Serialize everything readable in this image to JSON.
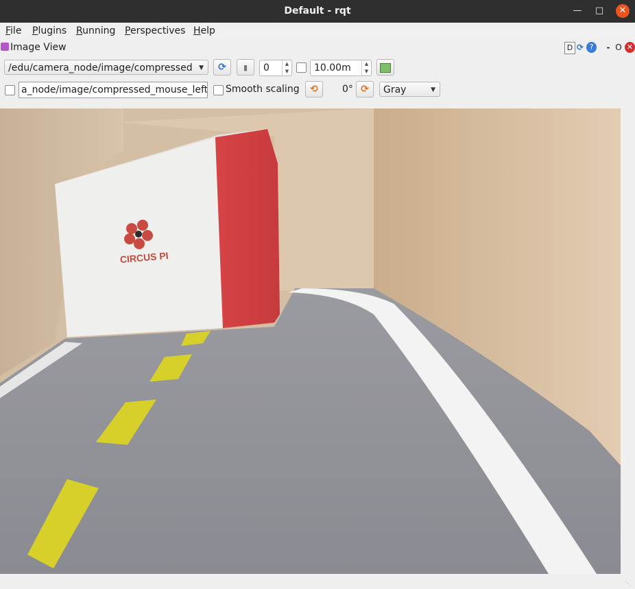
{
  "window": {
    "title": "Default - rqt"
  },
  "menu": [
    {
      "mnemonic": "F",
      "rest": "ile"
    },
    {
      "mnemonic": "P",
      "rest": "lugins"
    },
    {
      "mnemonic": "R",
      "rest": "unning"
    },
    {
      "mnemonic": "P",
      "rest": "erspectives"
    },
    {
      "mnemonic": "H",
      "rest": "elp"
    }
  ],
  "plugin": {
    "title": "Image View",
    "header_buttons": {
      "dock": "D",
      "minimize": "-",
      "float": "O"
    }
  },
  "toolbar": {
    "topic": "/edu/camera_node/image/compressed",
    "queue_value": "0",
    "timeout_value": "10.00m",
    "mouse_topic": "a_node/image/compressed_mouse_left",
    "smooth_scaling_label": "Smooth scaling",
    "rotation_label": "0°",
    "color_scheme": "Gray"
  },
  "image": {
    "box_text": "CIRCUS PI",
    "colors": {
      "floor": "#8f8f93",
      "wall": "#d9c2a6",
      "box_red": "#d9484a",
      "lane_yellow": "#d8d02a",
      "lane_white": "#f4f4f4"
    }
  }
}
